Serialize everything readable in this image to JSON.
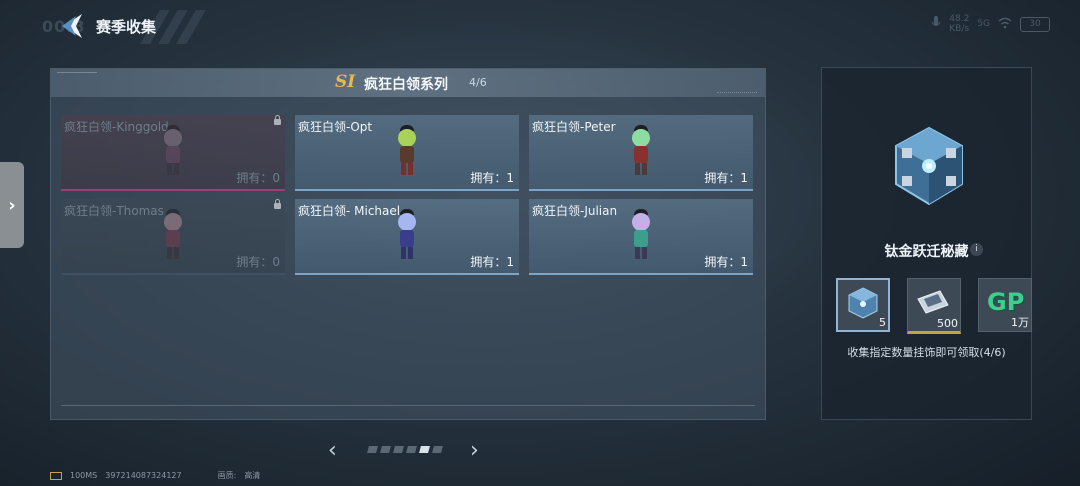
{
  "header": {
    "time_ghost": "00:3",
    "title": "赛季收集",
    "status": {
      "speed": "48.2",
      "speed_unit": "KB/s",
      "net": "5G",
      "battery": "30"
    }
  },
  "series": {
    "logo": "SI",
    "title": "疯狂白领系列",
    "count": "4/6"
  },
  "cards": [
    {
      "name": "疯狂白领-Kinggold",
      "own": "拥有：0",
      "locked": true,
      "palette": {
        "head": "#8a7b88",
        "body": "#6a4a64",
        "legs": "#3a3040"
      }
    },
    {
      "name": "疯狂白领-Opt",
      "own": "拥有：1",
      "locked": false,
      "palette": {
        "head": "#a8d25a",
        "body": "#5a3a2e",
        "legs": "#7a2e28"
      }
    },
    {
      "name": "疯狂白领-Peter",
      "own": "拥有：1",
      "locked": false,
      "palette": {
        "head": "#8fdca0",
        "body": "#8a3030",
        "legs": "#4a3a3a"
      }
    },
    {
      "name": "疯狂白领-Thomas",
      "own": "拥有：0",
      "locked": true,
      "palette": {
        "head": "#b08a96",
        "body": "#7a3a4e",
        "legs": "#3a2e38"
      }
    },
    {
      "name": "疯狂白领- Michael",
      "own": "拥有：1",
      "locked": false,
      "palette": {
        "head": "#a6b6f0",
        "body": "#3a3e8a",
        "legs": "#2e3266"
      }
    },
    {
      "name": "疯狂白领-Julian",
      "own": "拥有：1",
      "locked": false,
      "palette": {
        "head": "#c4b0e8",
        "body": "#3e9e8e",
        "legs": "#3a3a54"
      }
    }
  ],
  "pager": {
    "total": 6,
    "active": 5
  },
  "reward": {
    "name": "钛金跃迁秘藏",
    "info": "i",
    "items": [
      {
        "icon": "cube-crate-icon",
        "qty": "5"
      },
      {
        "icon": "ticket-icon",
        "qty": "500"
      },
      {
        "icon": "gp-coin-icon",
        "label": "GP",
        "qty": "1万"
      }
    ],
    "desc": "收集指定数量挂饰即可领取(4/6)"
  },
  "footer": {
    "ping": "100MS",
    "uid": "397214087324127",
    "quality_label": "画质:",
    "quality": "高清"
  },
  "colors": {
    "accent_gold": "#e8b84a",
    "card_blue": "#7ea4c4",
    "locked_pink": "#9a3f78"
  }
}
